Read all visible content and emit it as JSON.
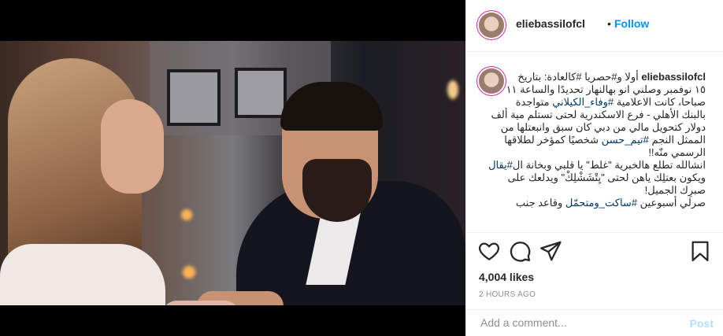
{
  "header": {
    "username": "eliebassilofcl",
    "separator": "•",
    "follow_label": "Follow"
  },
  "caption": {
    "username": "eliebassilofcl",
    "line1_rest": "أولا و#حصريا #كالعادة: بتاريخ",
    "lines": [
      "١٥ نوفمبر وصلني انو بهالنهار تحديدًا والساعة ١١",
      "صباحا، كانت الاعلامية #وفاء_الكيلاني متواجدة",
      "بالبنك الأهلي - فرع الاسكندرية لحتى تستلم مية ألف",
      "دولار كتحويل مالي من دبي كان سبق وانبعتلها من",
      "الممثل النجم #تيم_حسن شخصيًا كمؤخر لطلاقها",
      "الرسمي منّه!!",
      "انشالله تطلع هالخبرية \"غلط\" يا قلبي وبخانة ال#يقال",
      "ويكون بعتلِك ياهن لحتى \"يِتْشَشْلِكْ\" ويدلعك على",
      "صبرِك الجميل!",
      "صرلي أسبوعين #ساكت_ومتحمّل وقاعد جنب"
    ]
  },
  "actions": {
    "like_icon": "heart-icon",
    "comment_icon": "comment-icon",
    "share_icon": "paper-plane-icon",
    "save_icon": "bookmark-icon"
  },
  "likes_text": "4,004 likes",
  "timestamp": "2 HOURS AGO",
  "add_comment": {
    "placeholder": "Add a comment...",
    "post_label": "Post"
  },
  "colors": {
    "link": "#0095f6",
    "post_disabled": "#b2dffc",
    "hashtag": "#00376b",
    "text": "#262626",
    "muted": "#8e8e8e"
  }
}
